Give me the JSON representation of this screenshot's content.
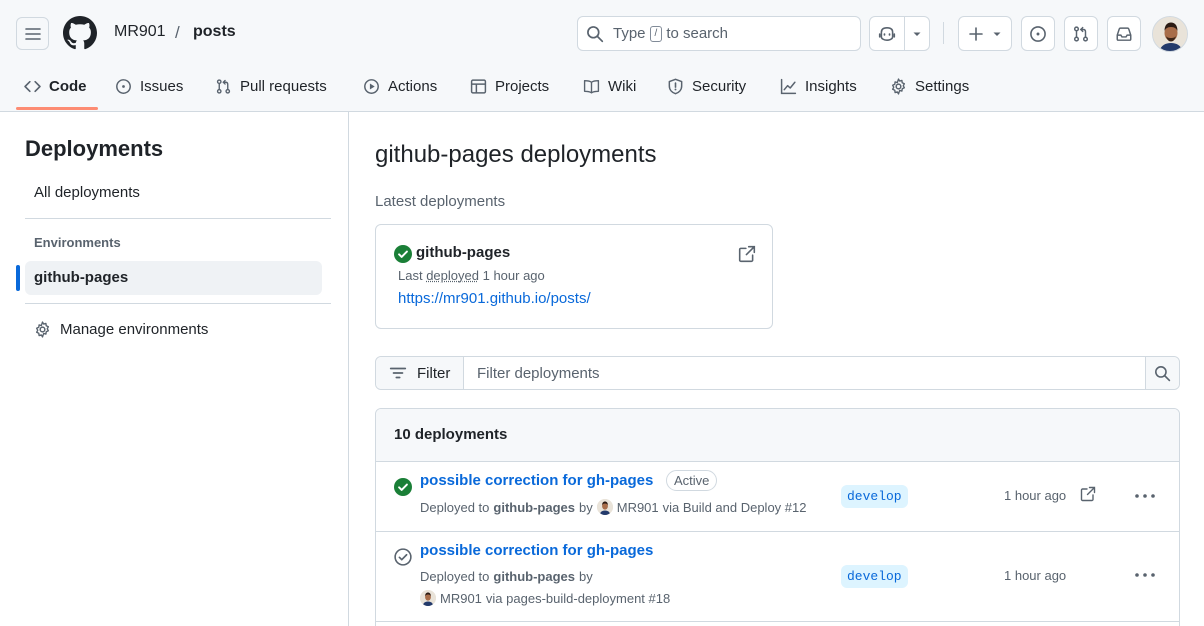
{
  "header": {
    "owner": "MR901",
    "separator": "/",
    "repo": "posts",
    "search": {
      "prefix": "Type",
      "key": "/",
      "suffix": "to search"
    }
  },
  "tabs": [
    {
      "label": "Code",
      "icon": "code-icon",
      "active": true
    },
    {
      "label": "Issues",
      "icon": "issue-opened-icon"
    },
    {
      "label": "Pull requests",
      "icon": "git-pull-request-icon"
    },
    {
      "label": "Actions",
      "icon": "play-icon"
    },
    {
      "label": "Projects",
      "icon": "table-icon"
    },
    {
      "label": "Wiki",
      "icon": "book-icon"
    },
    {
      "label": "Security",
      "icon": "shield-icon"
    },
    {
      "label": "Insights",
      "icon": "graph-icon"
    },
    {
      "label": "Settings",
      "icon": "gear-icon"
    }
  ],
  "sidebar": {
    "title": "Deployments",
    "all": "All deployments",
    "env_heading": "Environments",
    "selected_env": "github-pages",
    "manage": "Manage environments"
  },
  "main": {
    "title": "github-pages deployments",
    "latest_label": "Latest deployments"
  },
  "latest": {
    "name": "github-pages",
    "last_prefix": "Last",
    "deployed_word": "deployed",
    "time": "1 hour ago",
    "url": "https://mr901.github.io/posts/"
  },
  "filter": {
    "button": "Filter",
    "placeholder": "Filter deployments"
  },
  "deployments": {
    "count_label": "10 deployments",
    "rows": [
      {
        "title": "possible correction for gh-pages",
        "badge": "Active",
        "status": "success",
        "deployed_to": "Deployed to",
        "env": "github-pages",
        "by": "by",
        "user": "MR901",
        "via": "via Build and Deploy #12",
        "branch": "develop",
        "time": "1 hour ago"
      },
      {
        "title": "possible correction for gh-pages",
        "status": "inactive",
        "deployed_to": "Deployed to",
        "env": "github-pages",
        "by": "by",
        "user": "MR901",
        "via": "via pages-build-deployment #18",
        "branch": "develop",
        "time": "1 hour ago"
      }
    ]
  },
  "colors": {
    "accent": "#0969da",
    "success": "#1a7f37",
    "tab_underline": "#fd8c73",
    "header_bg": "#f6f8fa",
    "border": "#d1d9e0"
  }
}
